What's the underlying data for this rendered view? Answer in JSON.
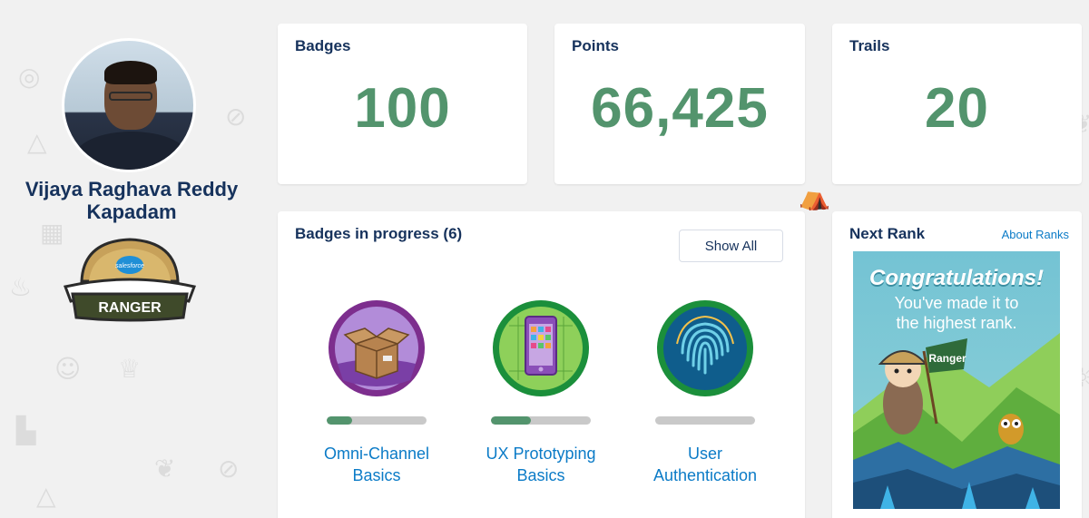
{
  "profile": {
    "name": "Vijaya Raghava Reddy Kapadam",
    "rank_label": "RANGER",
    "rank_brand": "salesforce"
  },
  "stats": [
    {
      "label": "Badges",
      "value": "100"
    },
    {
      "label": "Points",
      "value": "66,425"
    },
    {
      "label": "Trails",
      "value": "20"
    }
  ],
  "in_progress": {
    "title": "Badges in progress (6)",
    "show_all_label": "Show All",
    "badges": [
      {
        "label_line1": "Omni-Channel",
        "label_line2": "Basics",
        "icon": "open-box-icon",
        "progress": 0.25
      },
      {
        "label_line1": "UX Prototyping",
        "label_line2": "Basics",
        "icon": "phone-prototype-icon",
        "progress": 0.4
      },
      {
        "label_line1": "User",
        "label_line2": "Authentication",
        "icon": "fingerprint-icon",
        "progress": 0.0
      }
    ]
  },
  "next_rank": {
    "title": "Next Rank",
    "about_link": "About Ranks",
    "poster_title": "Congratulations!",
    "poster_line1": "You've made it to",
    "poster_line2": "the highest rank.",
    "flag_text": "Ranger"
  },
  "colors": {
    "accent_green": "#53946d",
    "link_blue": "#0b7bc7",
    "heading_navy": "#16325c"
  }
}
